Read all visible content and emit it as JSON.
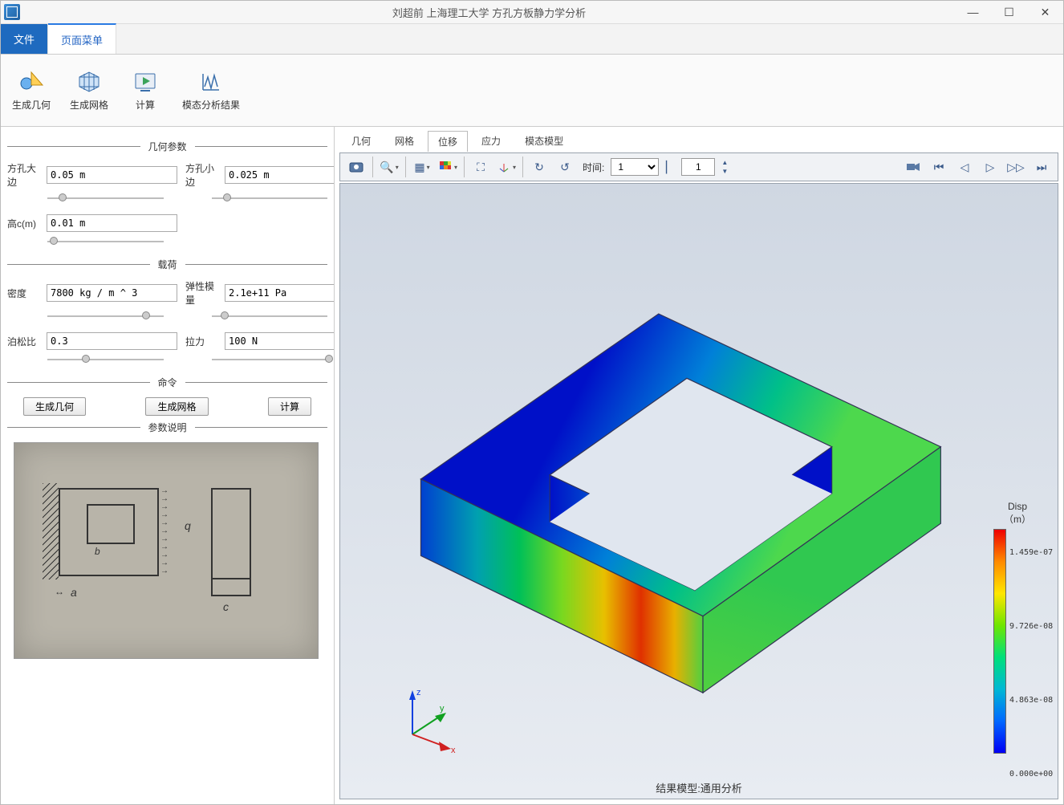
{
  "title": "刘超前   上海理工大学  方孔方板静力学分析",
  "window_buttons": {
    "min": "—",
    "max": "☐",
    "close": "✕"
  },
  "menu_tabs": {
    "file": "文件",
    "page_menu": "页面菜单"
  },
  "ribbon": {
    "gen_geom": "生成几何",
    "gen_mesh": "生成网格",
    "compute": "计算",
    "modal_results": "模态分析结果"
  },
  "sections": {
    "geom_params": "几何参数",
    "load": "载荷",
    "commands": "命令",
    "param_desc": "参数说明"
  },
  "fields": {
    "big_edge": {
      "label": "方孔大边",
      "value": "0.05 m"
    },
    "small_edge": {
      "label": "方孔小边",
      "value": "0.025 m"
    },
    "height_c": {
      "label": "高c(m)",
      "value": "0.01 m"
    },
    "density": {
      "label": "密度",
      "value": "7800 kg / m ^ 3"
    },
    "elastic": {
      "label": "弹性模量",
      "value": "2.1e+11 Pa"
    },
    "poisson": {
      "label": "泊松比",
      "value": "0.3"
    },
    "force": {
      "label": "拉力",
      "value": "100 N"
    }
  },
  "buttons": {
    "gen_geom": "生成几何",
    "gen_mesh": "生成网格",
    "compute": "计算"
  },
  "main_tabs": [
    "几何",
    "网格",
    "位移",
    "应力",
    "模态模型"
  ],
  "main_active_tab": 2,
  "toolbar": {
    "time_label": "时间:",
    "time_value": "1",
    "frame_value": "1"
  },
  "legend": {
    "title": "Disp\n（m）",
    "max": "1.459e-07",
    "mid1": "9.726e-08",
    "mid2": "4.863e-08",
    "min": "0.000e+00"
  },
  "viewport_footer": "结果模型:通用分析",
  "axes": {
    "x": "x",
    "y": "y",
    "z": "z"
  }
}
